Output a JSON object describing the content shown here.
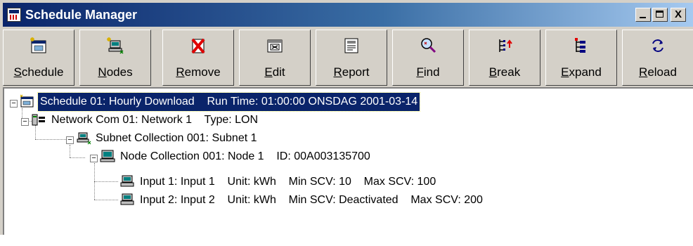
{
  "window": {
    "title": "Schedule Manager",
    "controls": {
      "minimize": "_",
      "maximize": "□",
      "close": "X"
    }
  },
  "toolbar": {
    "buttons": [
      {
        "label": "Schedule",
        "icon": "schedule-icon"
      },
      {
        "label": "Nodes",
        "icon": "nodes-icon"
      },
      {
        "label": "Remove",
        "icon": "remove-icon"
      },
      {
        "label": "Edit",
        "icon": "edit-icon"
      },
      {
        "label": "Report",
        "icon": "report-icon"
      },
      {
        "label": "Find",
        "icon": "find-icon"
      },
      {
        "label": "Break",
        "icon": "break-icon"
      },
      {
        "label": "Expand",
        "icon": "expand-icon"
      },
      {
        "label": "Reload",
        "icon": "reload-icon"
      }
    ]
  },
  "tree": {
    "schedule": {
      "text": "Schedule 01: Hourly Download    Run Time: 01:00:00 ONSDAG 2001-03-14",
      "expander": "−",
      "selected": true
    },
    "network": {
      "text": "Network Com 01: Network 1    Type: LON",
      "expander": "−"
    },
    "subnet": {
      "text": "Subnet Collection 001: Subnet 1",
      "expander": "−"
    },
    "node": {
      "text": "Node Collection 001: Node 1    ID: 00A003135700",
      "expander": "−"
    },
    "input1": {
      "text": "Input 1: Input 1    Unit: kWh    Min SCV: 10    Max SCV: 100"
    },
    "input2": {
      "text": "Input 2: Input 2    Unit: kWh    Min SCV: Deactivated    Max SCV: 200"
    }
  },
  "colors": {
    "titlebar": "#0a246a",
    "selection": "#0a246a",
    "face": "#d4d0c8"
  }
}
